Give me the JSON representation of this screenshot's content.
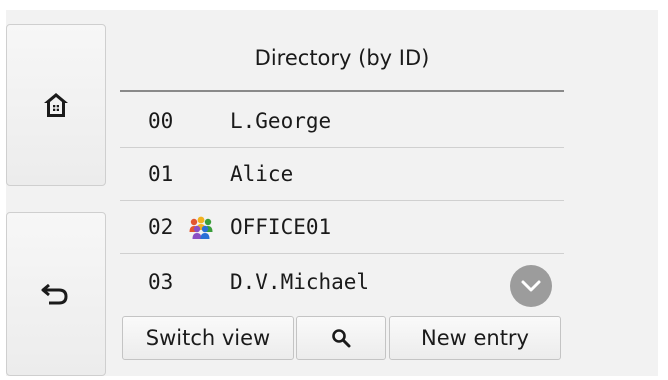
{
  "title": "Directory (by ID)",
  "entries": [
    {
      "id": "00",
      "name": "L.George",
      "group": false
    },
    {
      "id": "01",
      "name": "Alice",
      "group": false
    },
    {
      "id": "02",
      "name": "OFFICE01",
      "group": true
    },
    {
      "id": "03",
      "name": "D.V.Michael",
      "group": false
    }
  ],
  "buttons": {
    "switch_view": "Switch view",
    "new_entry": "New entry"
  },
  "icons": {
    "home": "home-icon",
    "back": "back-arrow-icon",
    "search": "magnifier-icon",
    "group": "group-people-icon",
    "scroll": "chevron-down-icon"
  }
}
